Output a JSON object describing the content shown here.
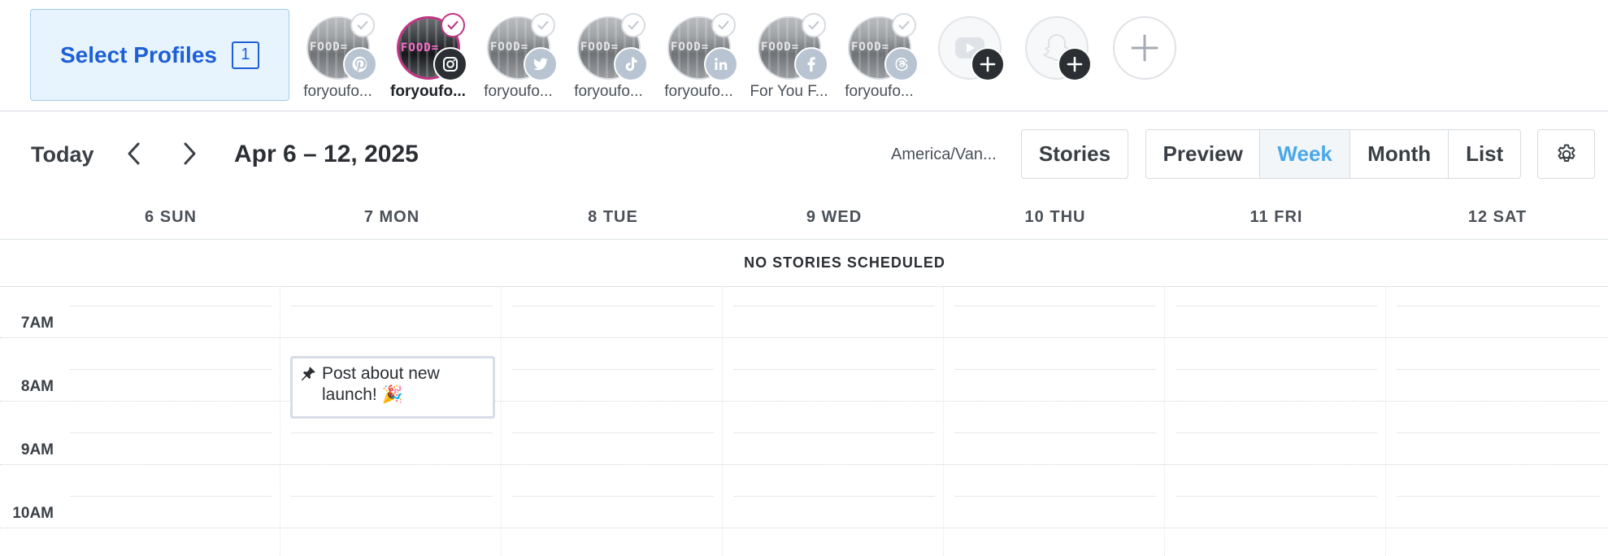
{
  "header": {
    "select_profiles_label": "Select Profiles",
    "selected_count": "1"
  },
  "profiles": [
    {
      "name": "foryoufo...",
      "network": "pinterest",
      "active": false
    },
    {
      "name": "foryoufo...",
      "network": "instagram",
      "active": true
    },
    {
      "name": "foryoufo...",
      "network": "twitter",
      "active": false
    },
    {
      "name": "foryoufo...",
      "network": "tiktok",
      "active": false
    },
    {
      "name": "foryoufo...",
      "network": "linkedin",
      "active": false
    },
    {
      "name": "For You F...",
      "network": "facebook",
      "active": false
    },
    {
      "name": "foryoufo...",
      "network": "threads",
      "active": false
    }
  ],
  "avatar_word": "FOOD=",
  "toolbar": {
    "today_label": "Today",
    "date_range": "Apr 6 – 12, 2025",
    "timezone": "America/Van...",
    "stories_label": "Stories",
    "views": [
      "Preview",
      "Week",
      "Month",
      "List"
    ],
    "active_view": "Week"
  },
  "calendar": {
    "days": [
      "6 SUN",
      "7 MON",
      "8 TUE",
      "9 WED",
      "10 THU",
      "11 FRI",
      "12 SAT"
    ],
    "no_stories_text": "NO STORIES SCHEDULED",
    "hours": [
      "7AM",
      "8AM",
      "9AM",
      "10AM"
    ],
    "event": {
      "title": "Post about new launch! 🎉"
    }
  },
  "colors": {
    "accent_blue": "#1d5fd6",
    "active_view": "#4ca8e8",
    "instagram_ring": "#c13584"
  }
}
